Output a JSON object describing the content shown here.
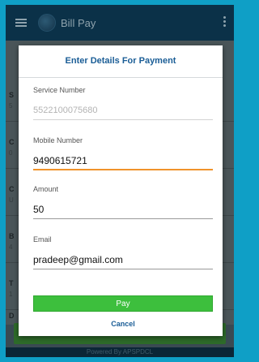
{
  "appbar": {
    "title": "Bill Pay"
  },
  "background_rows": [
    {
      "ch": "S",
      "sub": "5"
    },
    {
      "ch": "C",
      "sub": "0"
    },
    {
      "ch": "C",
      "sub": "U"
    },
    {
      "ch": "B",
      "sub": "4"
    },
    {
      "ch": "T",
      "sub": "1"
    },
    {
      "ch": "D",
      "sub": ""
    }
  ],
  "dialog": {
    "title": "Enter Details For Payment",
    "fields": [
      {
        "label": "Service Number",
        "value": "5522100075680"
      },
      {
        "label": "Mobile Number",
        "value": "9490615721"
      },
      {
        "label": "Amount",
        "value": "50"
      },
      {
        "label": "Email",
        "value": "pradeep@gmail.com"
      }
    ],
    "pay_label": "Pay",
    "cancel_label": "Cancel"
  },
  "footer": {
    "text": "Powered By APSPDCL"
  },
  "colors": {
    "accent": "#1a5d96",
    "pay": "#3dbf3d",
    "focus": "#f0932b"
  }
}
